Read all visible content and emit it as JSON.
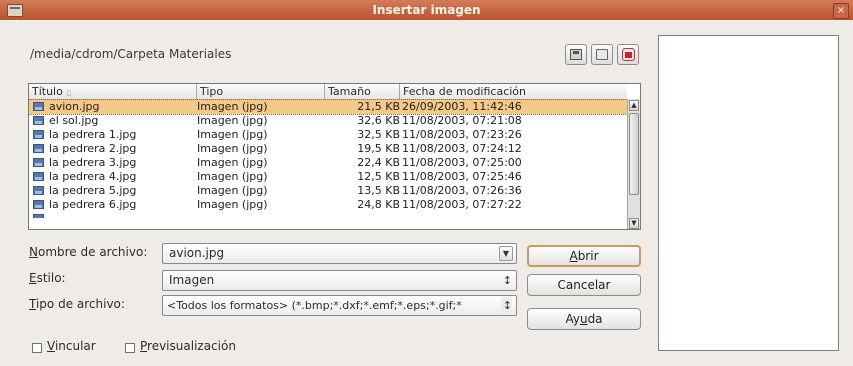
{
  "window": {
    "title": "Insertar imagen",
    "close_glyph": "×"
  },
  "path": "/media/cdrom/Carpeta Materiales",
  "toolbar": {
    "icons": [
      "up-folder-icon",
      "new-folder-icon",
      "home-icon"
    ]
  },
  "file_list": {
    "columns": [
      "Título",
      "Tipo",
      "Tamaño",
      "Fecha de modificación"
    ],
    "rows": [
      {
        "name": "avion.jpg",
        "type": "Imagen (jpg)",
        "size": "21,5 KB",
        "date": "26/09/2003, 11:42:46",
        "selected": true
      },
      {
        "name": "el sol.jpg",
        "type": "Imagen (jpg)",
        "size": "32,6 KB",
        "date": "11/08/2003, 07:21:08"
      },
      {
        "name": "la pedrera 1.jpg",
        "type": "Imagen (jpg)",
        "size": "32,5 KB",
        "date": "11/08/2003, 07:23:26"
      },
      {
        "name": "la pedrera 2.jpg",
        "type": "Imagen (jpg)",
        "size": "19,5 KB",
        "date": "11/08/2003, 07:24:12"
      },
      {
        "name": "la pedrera 3.jpg",
        "type": "Imagen (jpg)",
        "size": "22,4 KB",
        "date": "11/08/2003, 07:25:00"
      },
      {
        "name": "la pedrera 4.jpg",
        "type": "Imagen (jpg)",
        "size": "12,5 KB",
        "date": "11/08/2003, 07:25:46"
      },
      {
        "name": "la pedrera 5.jpg",
        "type": "Imagen (jpg)",
        "size": "13,5 KB",
        "date": "11/08/2003, 07:26:36"
      },
      {
        "name": "la pedrera 6.jpg",
        "type": "Imagen (jpg)",
        "size": "24,8 KB",
        "date": "11/08/2003, 07:27:22"
      }
    ]
  },
  "form": {
    "filename_label": {
      "key": "N",
      "rest": "ombre de archivo:"
    },
    "filename_value": "avion.jpg",
    "style_label": {
      "key": "E",
      "rest": "stilo:"
    },
    "style_value": "Imagen",
    "filetype_label": {
      "key": "T",
      "rest": "ipo de archivo:"
    },
    "filetype_value": "<Todos los formatos> (*.bmp;*.dxf;*.emf;*.eps;*.gif;*"
  },
  "buttons": {
    "open": {
      "key": "A",
      "rest": "brir"
    },
    "cancel": "Cancelar",
    "help": {
      "pre": "Ay",
      "key": "u",
      "rest": "da"
    }
  },
  "options": {
    "link": {
      "key": "V",
      "rest": "incular",
      "checked": false
    },
    "preview": {
      "key": "P",
      "rest": "revisualización",
      "checked": false
    }
  },
  "colors": {
    "titlebar": "#c0603c",
    "selection": "#f4c885",
    "default_button_border": "#c99a62"
  }
}
